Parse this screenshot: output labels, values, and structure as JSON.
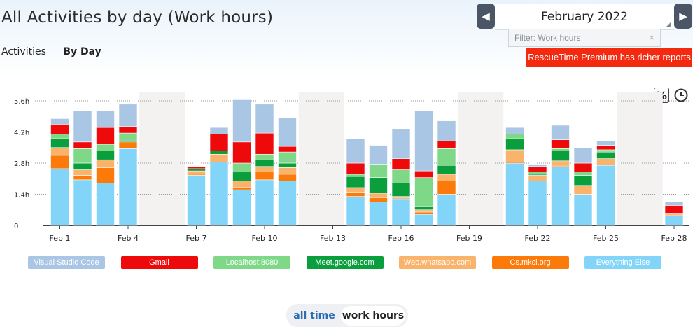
{
  "page": {
    "title": "All Activities by day (Work hours)"
  },
  "subnav": {
    "activities": "Activities",
    "by_day": "By Day"
  },
  "date_picker": {
    "label": "February 2022",
    "prev_icon": "triangle-left-icon",
    "next_icon": "triangle-right-icon"
  },
  "filter": {
    "value": "Filter: Work hours",
    "clear": "×"
  },
  "premium": {
    "label": "RescueTime Premium has richer reports"
  },
  "tools": {
    "percent": "%",
    "clock_icon": "clock-icon"
  },
  "toggle": {
    "all_time": "all time",
    "work_hours": "work hours"
  },
  "colors": {
    "Visual Studio Code": "#a9c6e4",
    "Gmail": "#ee0a0a",
    "Localhost:8080": "#7ed888",
    "Meet.google.com": "#0a9e3d",
    "Web.whatsapp.com": "#f9b36a",
    "Cs.mkcl.org": "#fc7a0a",
    "Everything Else": "#83d4f9"
  },
  "chart_data": {
    "type": "bar",
    "stacked": true,
    "y_unit": "hours",
    "ylim": [
      0,
      6.0
    ],
    "yticks": [
      "0",
      "1.4h",
      "2.8h",
      "4.2h",
      "5.6h"
    ],
    "ytick_values": [
      0,
      1.4,
      2.8,
      4.2,
      5.6
    ],
    "xticks": [
      "Feb 1",
      "Feb 4",
      "Feb 7",
      "Feb 10",
      "Feb 13",
      "Feb 16",
      "Feb 19",
      "Feb 22",
      "Feb 25",
      "Feb 28"
    ],
    "xtick_days": [
      1,
      4,
      7,
      10,
      13,
      16,
      19,
      22,
      25,
      28
    ],
    "weekend_days": [
      5,
      6,
      12,
      13,
      19,
      20,
      26,
      27
    ],
    "days": [
      1,
      2,
      3,
      4,
      7,
      8,
      9,
      10,
      11,
      14,
      15,
      16,
      17,
      18,
      21,
      22,
      23,
      24,
      25,
      28
    ],
    "legend_position": "bottom",
    "grid": true,
    "series": [
      {
        "name": "Everything Else",
        "values": [
          2.55,
          2.05,
          1.9,
          3.45,
          2.25,
          2.85,
          1.6,
          2.05,
          2.0,
          1.3,
          1.05,
          1.2,
          0.5,
          1.4,
          2.8,
          2.0,
          2.65,
          1.4,
          2.7,
          0.45
        ]
      },
      {
        "name": "Cs.mkcl.org",
        "values": [
          0.6,
          0.2,
          0.7,
          0.3,
          0.05,
          0.0,
          0.1,
          0.35,
          0.3,
          0.2,
          0.2,
          0.05,
          0.1,
          0.6,
          0.05,
          0.0,
          0.05,
          0.0,
          0.0,
          0.05
        ]
      },
      {
        "name": "Web.whatsapp.com",
        "values": [
          0.35,
          0.25,
          0.35,
          0.0,
          0.15,
          0.35,
          0.3,
          0.25,
          0.3,
          0.2,
          0.2,
          0.05,
          0.1,
          0.3,
          0.55,
          0.25,
          0.2,
          0.4,
          0.3,
          0.05
        ]
      },
      {
        "name": "Meet.google.com",
        "values": [
          0.4,
          0.3,
          0.4,
          0.05,
          0.1,
          0.15,
          0.4,
          0.3,
          0.2,
          0.5,
          0.7,
          0.6,
          0.15,
          0.4,
          0.5,
          0.05,
          0.45,
          0.45,
          0.3,
          0.0
        ]
      },
      {
        "name": "Localhost:8080",
        "values": [
          0.2,
          0.65,
          0.3,
          0.35,
          0.0,
          0.0,
          0.4,
          0.25,
          0.5,
          0.1,
          0.6,
          0.6,
          1.3,
          0.75,
          0.2,
          0.1,
          0.1,
          0.15,
          0.1,
          0.0
        ]
      },
      {
        "name": "Gmail",
        "values": [
          0.45,
          0.3,
          0.75,
          0.3,
          0.1,
          0.75,
          0.95,
          0.95,
          0.25,
          0.5,
          0.0,
          0.5,
          0.3,
          0.35,
          0.0,
          0.25,
          0.4,
          0.4,
          0.2,
          0.35
        ]
      },
      {
        "name": "Visual Studio Code",
        "values": [
          0.25,
          1.4,
          0.75,
          1.0,
          0.0,
          0.3,
          1.9,
          1.3,
          1.3,
          1.1,
          0.85,
          1.35,
          2.7,
          0.9,
          0.3,
          0.1,
          0.65,
          0.7,
          0.2,
          0.15
        ]
      }
    ]
  }
}
